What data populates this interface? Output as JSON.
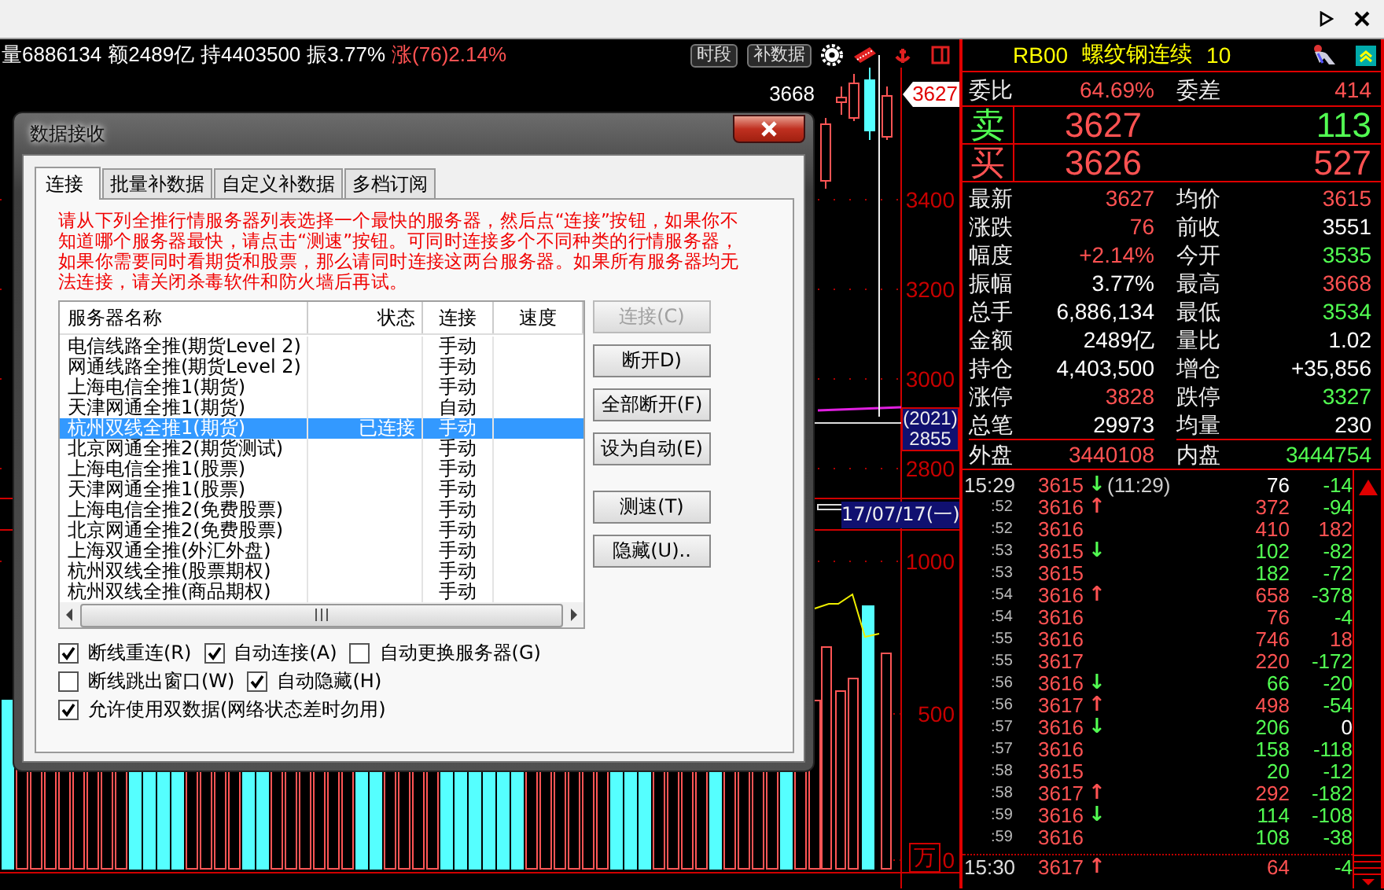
{
  "quote_line": {
    "items": [
      {
        "text": "量6886134",
        "color": "#ffffff"
      },
      {
        "text": "额2489亿",
        "color": "#ffffff"
      },
      {
        "text": "持4403500",
        "color": "#ffffff"
      },
      {
        "text": "振3.77%",
        "color": "#ffffff"
      },
      {
        "text": "涨(76)2.14%",
        "color": "#ff5252"
      }
    ],
    "buttons": [
      "时段",
      "补数据"
    ]
  },
  "chart": {
    "axis_labels": [
      {
        "text": "3400",
        "kind": "price"
      },
      {
        "text": "3200",
        "kind": "price"
      },
      {
        "text": "3000",
        "kind": "price"
      },
      {
        "text": "2800",
        "kind": "price"
      },
      {
        "text": "1000",
        "kind": "volume"
      },
      {
        "text": "500",
        "kind": "volume"
      },
      {
        "text": "0",
        "kind": "volume"
      }
    ],
    "high_label": "3668",
    "last_price": "3627",
    "ma_count": "(2021)",
    "ma_value": "2855",
    "date": "17/07/17(一)",
    "unit": "万"
  },
  "dialog": {
    "title": "数据接收",
    "tabs": [
      {
        "label": "连接",
        "selected": true
      },
      {
        "label": "批量补数据",
        "selected": false
      },
      {
        "label": "自定义补数据",
        "selected": false
      },
      {
        "label": "多档订阅",
        "selected": false
      }
    ],
    "notice": "请从下列全推行情服务器列表选择一个最快的服务器，然后点“连接”按钮，如果你不知道哪个服务器最快，请点击“测速”按钮。可同时连接多个不同种类的行情服务器，如果你需要同时看期货和股票，那么请同时连接这两台服务器。如果所有服务器均无法连接，请关闭杀毒软件和防火墙后再试。",
    "columns": [
      "服务器名称",
      "状态",
      "连接",
      "速度"
    ],
    "servers": [
      {
        "name": "电信线路全推(期货Level 2)",
        "mode": "手动",
        "selected": false
      },
      {
        "name": "网通线路全推(期货Level 2)",
        "mode": "手动",
        "selected": false
      },
      {
        "name": "上海电信全推1(期货)",
        "mode": "手动",
        "selected": false
      },
      {
        "name": "天津网通全推1(期货)",
        "mode": "自动",
        "selected": false
      },
      {
        "name": "杭州双线全推1(期货)",
        "status": "已连接",
        "mode": "手动",
        "selected": true
      },
      {
        "name": "北京网通全推2(期货测试)",
        "mode": "手动",
        "selected": false
      },
      {
        "name": "上海电信全推1(股票)",
        "mode": "手动",
        "selected": false
      },
      {
        "name": "天津网通全推1(股票)",
        "mode": "手动",
        "selected": false
      },
      {
        "name": "上海电信全推2(免费股票)",
        "mode": "手动",
        "selected": false
      },
      {
        "name": "北京网通全推2(免费股票)",
        "mode": "手动",
        "selected": false
      },
      {
        "name": "上海双通全推(外汇外盘)",
        "mode": "手动",
        "selected": false
      },
      {
        "name": "杭州双线全推(股票期权)",
        "mode": "手动",
        "selected": false
      },
      {
        "name": "杭州双线全推(商品期权)",
        "mode": "手动",
        "selected": false
      }
    ],
    "button_groups": [
      [
        {
          "label": "连接(C)",
          "disabled": true
        },
        {
          "label": "断开D)",
          "disabled": false
        },
        {
          "label": "全部断开(F)",
          "disabled": false
        },
        {
          "label": "设为自动(E)",
          "disabled": false
        }
      ],
      [
        {
          "label": "测速(T)",
          "disabled": false
        },
        {
          "label": "隐藏(U)..",
          "disabled": false
        }
      ]
    ],
    "checkbox_rows": [
      [
        {
          "label": "断线重连(R)",
          "checked": true
        },
        {
          "label": "自动连接(A)",
          "checked": true
        },
        {
          "label": "自动更换服务器(G)",
          "checked": false
        }
      ],
      [
        {
          "label": "断线跳出窗口(W)",
          "checked": false
        },
        {
          "label": "自动隐藏(H)",
          "checked": true
        }
      ],
      [
        {
          "label": "允许使用双数据(网络状态差时勿用)",
          "checked": true
        }
      ]
    ]
  },
  "quote_panel": {
    "code": "RB00",
    "name": "螺纹钢连续",
    "count": "10",
    "order_stats": [
      {
        "label": "委比",
        "value": "64.69%",
        "color": "#ff5252"
      },
      {
        "label": "委差",
        "value": "414",
        "color": "#ff5252"
      }
    ],
    "book": [
      {
        "kind": "sell",
        "side": "卖",
        "price": "3627",
        "volume": {
          "text": "113",
          "color": "#52ff52"
        }
      },
      {
        "kind": "buy",
        "side": "买",
        "price": "3626",
        "volume": {
          "text": "527",
          "color": "#ff5252"
        }
      }
    ],
    "stats": [
      {
        "label": "最新",
        "value": "3627",
        "color": "#ff5252"
      },
      {
        "label": "均价",
        "value": "3615",
        "color": "#ff5252"
      },
      {
        "label": "涨跌",
        "value": "76",
        "color": "#ff5252"
      },
      {
        "label": "前收",
        "value": "3551",
        "color": "#ffffff"
      },
      {
        "label": "幅度",
        "value": "+2.14%",
        "color": "#ff5252"
      },
      {
        "label": "今开",
        "value": "3535",
        "color": "#52ff52"
      },
      {
        "label": "振幅",
        "value": "3.77%",
        "color": "#ffffff"
      },
      {
        "label": "最高",
        "value": "3668",
        "color": "#ff5252"
      },
      {
        "label": "总手",
        "value": "6,886,134",
        "color": "#ffffff"
      },
      {
        "label": "最低",
        "value": "3534",
        "color": "#52ff52"
      },
      {
        "label": "金额",
        "value": "2489亿",
        "color": "#ffffff"
      },
      {
        "label": "量比",
        "value": "1.02",
        "color": "#ffffff"
      },
      {
        "label": "持仓",
        "value": "4,403,500",
        "color": "#ffffff"
      },
      {
        "label": "增仓",
        "value": "+35,856",
        "color": "#ffffff"
      },
      {
        "label": "涨停",
        "value": "3828",
        "color": "#ff5252"
      },
      {
        "label": "跌停",
        "value": "3327",
        "color": "#52ff52"
      },
      {
        "label": "总笔",
        "value": "29973",
        "color": "#ffffff"
      },
      {
        "label": "均量",
        "value": "230",
        "color": "#ffffff"
      },
      {
        "label": "外盘",
        "value": "3440108",
        "color": "#ff5252"
      },
      {
        "label": "内盘",
        "value": "3444754",
        "color": "#52ff52"
      }
    ]
  },
  "ticks": [
    {
      "kind": "full",
      "time": "15:29",
      "price": "3615",
      "arrow": {
        "text": "↓",
        "color": "#52ff52"
      },
      "note": "(11:29)",
      "volume": {
        "text": "76",
        "color": "#ffffff"
      },
      "change": {
        "text": "-14",
        "color": "#52ff52"
      }
    },
    {
      "kind": "minute",
      "time": ":52",
      "price": "3616",
      "arrow": {
        "text": "↑",
        "color": "#ff5252"
      },
      "volume": {
        "text": "372",
        "color": "#ff5252"
      },
      "change": {
        "text": "-94",
        "color": "#52ff52"
      }
    },
    {
      "kind": "minute",
      "time": ":52",
      "price": "3616",
      "volume": {
        "text": "410",
        "color": "#ff5252"
      },
      "change": {
        "text": "182",
        "color": "#ff5252"
      }
    },
    {
      "kind": "minute",
      "time": ":53",
      "price": "3615",
      "arrow": {
        "text": "↓",
        "color": "#52ff52"
      },
      "volume": {
        "text": "102",
        "color": "#52ff52"
      },
      "change": {
        "text": "-82",
        "color": "#52ff52"
      }
    },
    {
      "kind": "minute",
      "time": ":53",
      "price": "3615",
      "volume": {
        "text": "182",
        "color": "#52ff52"
      },
      "change": {
        "text": "-72",
        "color": "#52ff52"
      }
    },
    {
      "kind": "minute",
      "time": ":54",
      "price": "3616",
      "arrow": {
        "text": "↑",
        "color": "#ff5252"
      },
      "volume": {
        "text": "658",
        "color": "#ff5252"
      },
      "change": {
        "text": "-378",
        "color": "#52ff52"
      }
    },
    {
      "kind": "minute",
      "time": ":54",
      "price": "3616",
      "volume": {
        "text": "76",
        "color": "#ff5252"
      },
      "change": {
        "text": "-4",
        "color": "#52ff52"
      }
    },
    {
      "kind": "minute",
      "time": ":55",
      "price": "3616",
      "volume": {
        "text": "746",
        "color": "#ff5252"
      },
      "change": {
        "text": "18",
        "color": "#ff5252"
      }
    },
    {
      "kind": "minute",
      "time": ":55",
      "price": "3617",
      "volume": {
        "text": "220",
        "color": "#ff5252"
      },
      "change": {
        "text": "-172",
        "color": "#52ff52"
      }
    },
    {
      "kind": "minute",
      "time": ":56",
      "price": "3616",
      "arrow": {
        "text": "↓",
        "color": "#52ff52"
      },
      "volume": {
        "text": "66",
        "color": "#52ff52"
      },
      "change": {
        "text": "-20",
        "color": "#52ff52"
      }
    },
    {
      "kind": "minute",
      "time": ":56",
      "price": "3617",
      "arrow": {
        "text": "↑",
        "color": "#ff5252"
      },
      "volume": {
        "text": "498",
        "color": "#ff5252"
      },
      "change": {
        "text": "-54",
        "color": "#52ff52"
      }
    },
    {
      "kind": "minute",
      "time": ":57",
      "price": "3616",
      "arrow": {
        "text": "↓",
        "color": "#52ff52"
      },
      "volume": {
        "text": "206",
        "color": "#52ff52"
      },
      "change": {
        "text": "0",
        "color": "#ffffff"
      }
    },
    {
      "kind": "minute",
      "time": ":57",
      "price": "3616",
      "volume": {
        "text": "158",
        "color": "#52ff52"
      },
      "change": {
        "text": "-118",
        "color": "#52ff52"
      }
    },
    {
      "kind": "minute",
      "time": ":58",
      "price": "3615",
      "volume": {
        "text": "20",
        "color": "#52ff52"
      },
      "change": {
        "text": "-12",
        "color": "#52ff52"
      }
    },
    {
      "kind": "minute",
      "time": ":58",
      "price": "3617",
      "arrow": {
        "text": "↑",
        "color": "#ff5252"
      },
      "volume": {
        "text": "292",
        "color": "#ff5252"
      },
      "change": {
        "text": "-182",
        "color": "#52ff52"
      }
    },
    {
      "kind": "minute",
      "time": ":59",
      "price": "3616",
      "arrow": {
        "text": "↓",
        "color": "#52ff52"
      },
      "volume": {
        "text": "114",
        "color": "#52ff52"
      },
      "change": {
        "text": "-108",
        "color": "#52ff52"
      }
    },
    {
      "kind": "minute",
      "time": ":59",
      "price": "3616",
      "volume": {
        "text": "108",
        "color": "#52ff52"
      },
      "change": {
        "text": "-38",
        "color": "#52ff52"
      }
    },
    {
      "kind": "full",
      "time": "15:30",
      "price": "3617",
      "arrow": {
        "text": "↑",
        "color": "#ff5252"
      },
      "volume": {
        "text": "64",
        "color": "#ff5252"
      },
      "change": {
        "text": "-4",
        "color": "#52ff52"
      }
    }
  ]
}
